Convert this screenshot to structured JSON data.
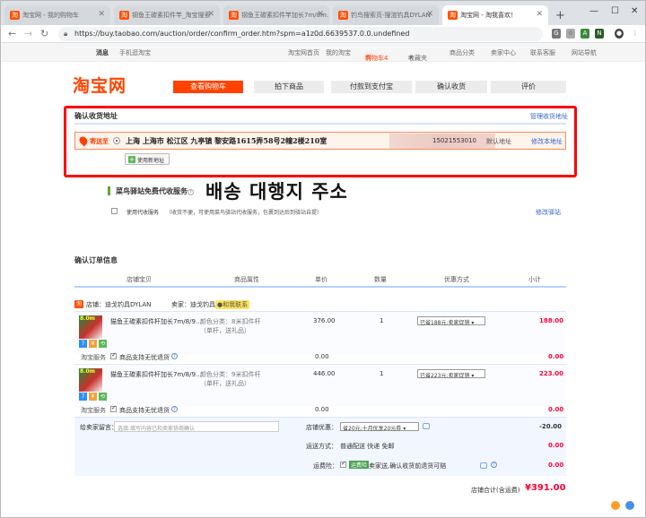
{
  "browser": {
    "tabs": [
      {
        "title": "淘宝网 - 我的购物车",
        "active": false
      },
      {
        "title": "钢鱼王碳素扣件竿_淘宝搜索",
        "active": false
      },
      {
        "title": "钢鱼王碳素扣件竿加长7m/8m…",
        "active": false
      },
      {
        "title": "钓鸟搜索页-搜渲钓具DYLAN",
        "active": false
      },
      {
        "title": "淘宝网 - 淘我喜欢！",
        "active": true
      }
    ],
    "url": "https://buy.taobao.com/auction/order/confirm_order.htm?spm=a1z0d.6639537.0.0.undefined"
  },
  "topnav": {
    "left": [
      "消息",
      "手机逛淘宝"
    ],
    "right": [
      "淘宝网首页",
      "我的淘宝",
      "购物车4",
      "收藏夹",
      "商品分类",
      "卖家中心",
      "联系客服",
      "网站导航"
    ]
  },
  "header": {
    "logo": "淘宝网",
    "steps": [
      "查看购物车",
      "拍下商品",
      "付款到支付宝",
      "确认收货",
      "评价"
    ]
  },
  "address": {
    "section_title": "确认收货地址",
    "manage_link": "管理收货地址",
    "ship_to_label": "寄送至",
    "address_text": "上海 上海市 松江区 九亭镇 黎安路1615弄58号2幢2楼210室",
    "phone": "15021553010",
    "default_label": "默认地址",
    "edit_link": "修改本地址",
    "new_address_button": "使用新地址"
  },
  "annotation": {
    "text": "배송 대행지 주소"
  },
  "station": {
    "title": "菜鸟驿站免费代收服务",
    "option_label": "使用代收服务",
    "option_desc": "（收货不便，可使用菜鸟驿站代收服务，包裹到达后到驿站自提）",
    "modify_link": "修改驿站"
  },
  "order": {
    "section_title": "确认订单信息",
    "columns": [
      "店铺宝贝",
      "商品属性",
      "单价",
      "数量",
      "优惠方式",
      "小计"
    ],
    "shop_label": "店铺：迪戈钓具DYLAN",
    "seller_label": "卖家：迪戈钓具",
    "contact_label": "和我联系",
    "items": [
      {
        "thumb_text": "8.0m",
        "title": "猫鱼王碳素扣件杆加长7m/8/9…",
        "attr": "颜色分类：8米扣件杆（单杆，送礼品）",
        "price": "376.00",
        "qty": "1",
        "discount": "已省188元:卖家促销",
        "subtotal": "188.00",
        "service_label": "淘宝服务",
        "service_value": "商品支持无忧退货",
        "service_price": "0.00"
      },
      {
        "thumb_text": "8.0m",
        "title": "猫鱼王碳素扣件杆加长7m/8/9…",
        "attr": "颜色分类：9米扣件杆（单杆，送礼品）",
        "price": "446.00",
        "qty": "1",
        "discount": "已省223元:卖家促销",
        "subtotal": "223.00",
        "service_label": "淘宝服务",
        "service_value": "商品支持无忧退货",
        "service_price": "0.00"
      }
    ],
    "message_label": "给卖家留言：",
    "message_placeholder": "选填:填写内容已和卖家协商确认",
    "coupon_label": "店铺优惠：",
    "coupon_value": "省20元:十月优享20元券",
    "coupon_amount": "-20.00",
    "shipping_label": "运送方式：",
    "shipping_value": "普通配送 快递 免邮",
    "shipping_amount": "0.00",
    "insurance_label": "运费险：",
    "insurance_badge": "运费险",
    "insurance_value": "卖家送,确认收货前退货可赔",
    "insurance_amount": "0.00",
    "total_label": "店铺合计(含运费)",
    "total_value": "¥391.00"
  },
  "colors": {
    "taobao_orange": "#ff4400",
    "highlight_red": "#ff0000",
    "price_red": "#ff0036",
    "link_blue": "#3366cc"
  }
}
